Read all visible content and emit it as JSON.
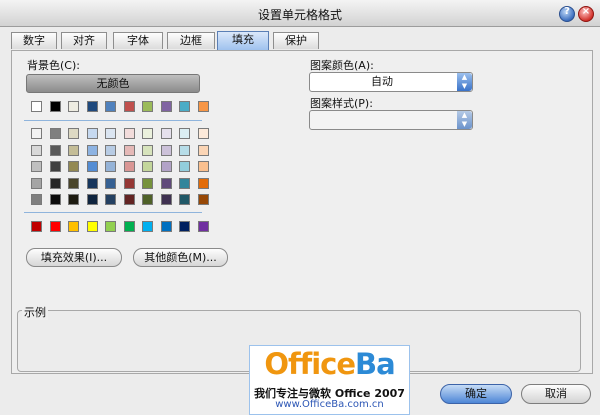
{
  "window": {
    "title": "设置单元格格式"
  },
  "tabs": [
    {
      "label": "数字",
      "active": false
    },
    {
      "label": "对齐",
      "active": false
    },
    {
      "label": "字体",
      "active": false
    },
    {
      "label": "边框",
      "active": false
    },
    {
      "label": "填充",
      "active": true
    },
    {
      "label": "保护",
      "active": false
    }
  ],
  "fill": {
    "background_label": "背景色(C):",
    "no_color_label": "无颜色",
    "palette": {
      "row1": [
        "#ffffff",
        "#000000",
        "#eeece1",
        "#1f497d",
        "#4f81bd",
        "#c0504d",
        "#9bbb59",
        "#8064a2",
        "#4bacc6",
        "#f79646"
      ],
      "tints": [
        [
          "#f2f2f2",
          "#7f7f7f",
          "#ddd9c3",
          "#c6d9f0",
          "#dbe5f1",
          "#f2dcdb",
          "#ebf1dd",
          "#e5e0ec",
          "#dbeef3",
          "#fdeada"
        ],
        [
          "#d8d8d8",
          "#595959",
          "#c4bd97",
          "#8db3e2",
          "#b8cce4",
          "#e5b9b7",
          "#d7e3bc",
          "#ccc1d9",
          "#b7dde8",
          "#fbd5b5"
        ],
        [
          "#bfbfbf",
          "#3f3f3f",
          "#938953",
          "#548dd4",
          "#95b3d7",
          "#d99694",
          "#c3d69b",
          "#b2a2c7",
          "#92cddc",
          "#fac08f"
        ],
        [
          "#a5a5a5",
          "#262626",
          "#494429",
          "#17365d",
          "#366092",
          "#953734",
          "#76923c",
          "#5f497a",
          "#31859b",
          "#e36c09"
        ],
        [
          "#7f7f7f",
          "#0c0c0c",
          "#1d1b10",
          "#0f243e",
          "#244061",
          "#632423",
          "#4f6128",
          "#3f3151",
          "#205867",
          "#974806"
        ]
      ],
      "standard": [
        "#c00000",
        "#ff0000",
        "#ffc000",
        "#ffff00",
        "#92d050",
        "#00b050",
        "#00b0f0",
        "#0070c0",
        "#002060",
        "#7030a0"
      ]
    },
    "fill_effects_label": "填充效果(I)...",
    "more_colors_label": "其他颜色(M)...",
    "pattern_color_label": "图案颜色(A):",
    "pattern_color_value": "自动",
    "pattern_style_label": "图案样式(P):",
    "pattern_style_value": "",
    "sample_label": "示例"
  },
  "watermark": {
    "brand_left": "Office",
    "brand_right": "Ba",
    "tagline": "我们专注与微软 Office 2007",
    "url": "www.OfficeBa.com.cn"
  },
  "buttons": {
    "ok_label": "确定",
    "cancel_label": "取消"
  },
  "colors": {
    "accent": "#3a73c9",
    "active_tab": "#9fc2ee"
  }
}
